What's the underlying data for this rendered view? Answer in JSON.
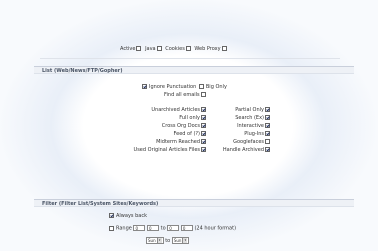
{
  "top_filters": [
    {
      "label": "Active",
      "checked": false
    },
    {
      "label": "Java",
      "checked": false
    },
    {
      "label": "Cookies",
      "checked": false
    },
    {
      "label": "Web Proxy",
      "checked": false
    }
  ],
  "section1": {
    "title": "List (Web/News/FTP/Gopher)",
    "toggles": [
      {
        "label": "Ignore Punctuation",
        "checked": true
      },
      {
        "label": "Big Only",
        "checked": false
      }
    ],
    "find_all": {
      "label": "Find all emails",
      "checked": false
    },
    "left_options": [
      {
        "label": "Unarchived Articles",
        "checked": true
      },
      {
        "label": "Full only",
        "checked": true
      },
      {
        "label": "Cross Org Docs",
        "checked": true
      },
      {
        "label": "Feed of (?)",
        "checked": true
      },
      {
        "label": "Midterm Reached",
        "checked": true
      },
      {
        "label": "Used Original Articles Files",
        "checked": true
      }
    ],
    "right_options": [
      {
        "label": "Partial Only",
        "checked": true
      },
      {
        "label": "Search (Ex)",
        "checked": true
      },
      {
        "label": "Interactive",
        "checked": true
      },
      {
        "label": "Plug-Ins",
        "checked": true
      },
      {
        "label": "Googlefaces",
        "checked": false
      },
      {
        "label": "Handle Archived",
        "checked": true
      }
    ]
  },
  "section2": {
    "title": "Filter (Filter List/System Sites/Keywords)",
    "always_back": {
      "label": "Always back",
      "checked": true
    },
    "range": {
      "label": "Range",
      "checked": false,
      "fields": [
        "0",
        "0",
        "0",
        "0"
      ],
      "separator": "to",
      "hint": "(24 hour format)"
    },
    "day_select": "Sun",
    "to_label": "to",
    "end_select": "Sun"
  },
  "colors": {
    "header_bg": "#eef1f6",
    "vignette": "#e9eff8"
  }
}
